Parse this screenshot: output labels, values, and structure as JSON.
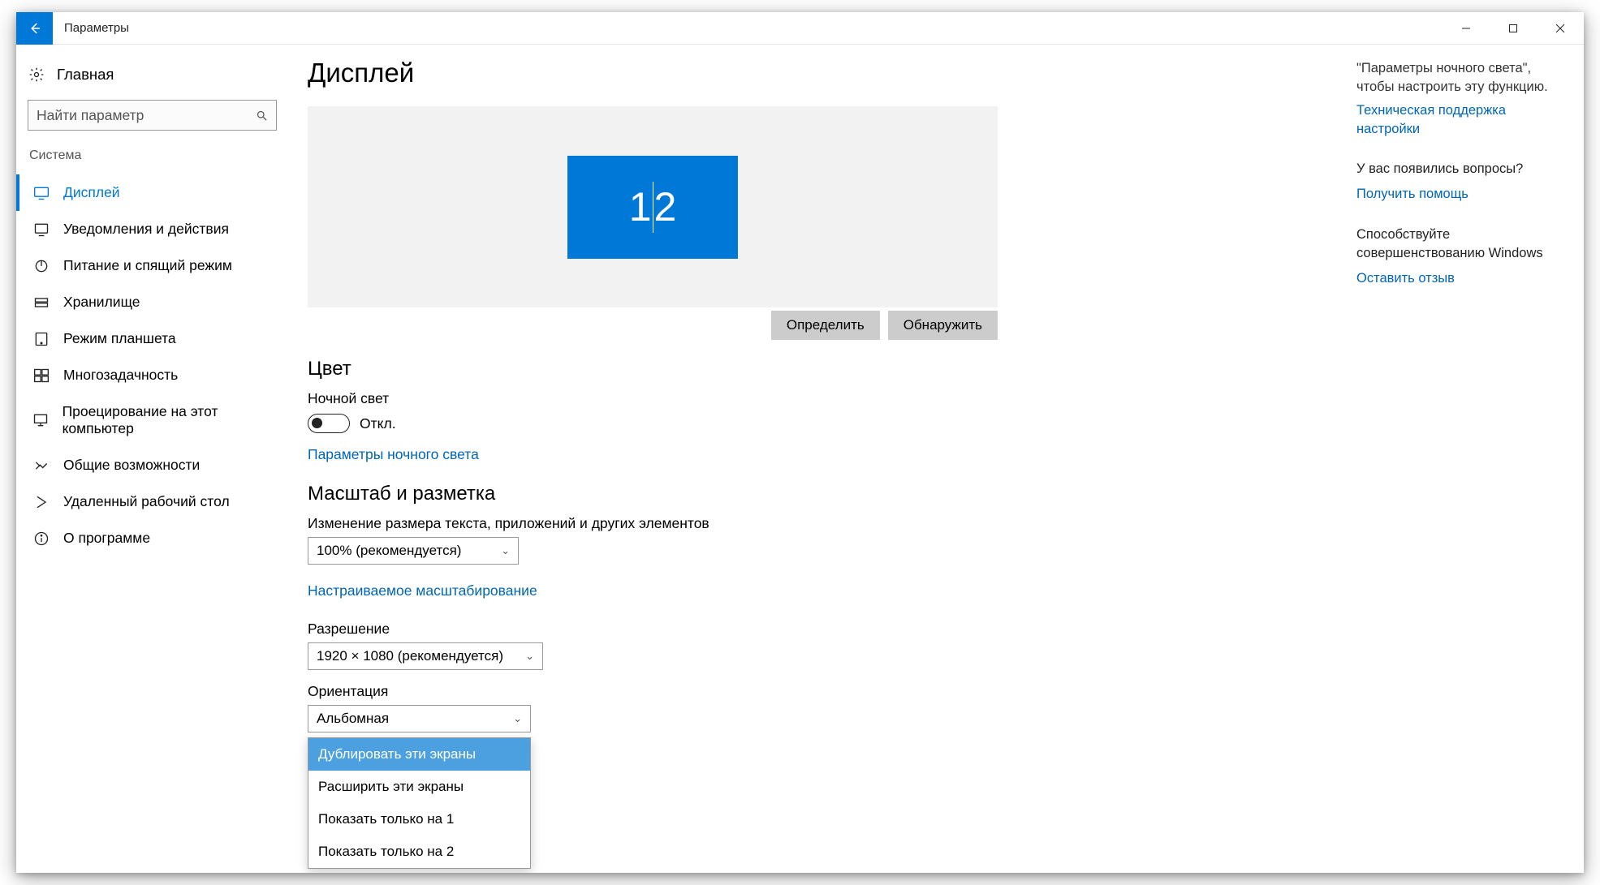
{
  "title_bar": {
    "app_name": "Параметры"
  },
  "sidebar": {
    "home": "Главная",
    "search_placeholder": "Найти параметр",
    "heading": "Система",
    "items": [
      {
        "label": "Дисплей"
      },
      {
        "label": "Уведомления и действия"
      },
      {
        "label": "Питание и спящий режим"
      },
      {
        "label": "Хранилище"
      },
      {
        "label": "Режим планшета"
      },
      {
        "label": "Многозадачность"
      },
      {
        "label": "Проецирование на этот компьютер"
      },
      {
        "label": "Общие возможности"
      },
      {
        "label": "Удаленный рабочий стол"
      },
      {
        "label": "О программе"
      }
    ]
  },
  "main": {
    "page_title": "Дисплей",
    "monitor_label_left": "1",
    "monitor_label_right": "2",
    "identify_btn": "Определить",
    "detect_btn": "Обнаружить",
    "color_section": "Цвет",
    "night_light_label": "Ночной свет",
    "night_light_state": "Откл.",
    "night_light_settings_link": "Параметры ночного света",
    "scale_section": "Масштаб и разметка",
    "scale_label": "Изменение размера текста, приложений и других элементов",
    "scale_value": "100% (рекомендуется)",
    "custom_scaling_link": "Настраиваемое масштабирование",
    "resolution_label": "Разрешение",
    "resolution_value": "1920 × 1080 (рекомендуется)",
    "orientation_label": "Ориентация",
    "orientation_value": "Альбомная",
    "multi_display_options": [
      "Дублировать эти экраны",
      "Расширить эти экраны",
      "Показать только на 1",
      "Показать только на 2"
    ]
  },
  "right": {
    "help_text": "\"Параметры ночного света\", чтобы настроить эту функцию.",
    "help_link": "Техническая поддержка настройки",
    "questions_head": "У вас появились вопросы?",
    "get_help_link": "Получить помощь",
    "feedback_head": "Способствуйте совершенствованию Windows",
    "feedback_link": "Оставить отзыв"
  }
}
